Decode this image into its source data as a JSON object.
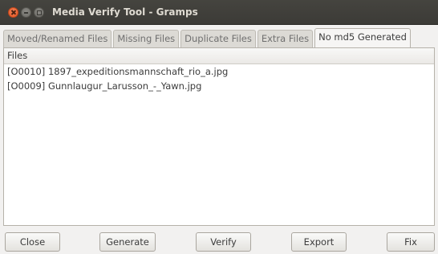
{
  "window": {
    "title": "Media Verify Tool - Gramps"
  },
  "tabs": [
    {
      "label": "Moved/Renamed Files",
      "active": false
    },
    {
      "label": "Missing Files",
      "active": false
    },
    {
      "label": "Duplicate Files",
      "active": false
    },
    {
      "label": "Extra Files",
      "active": false
    },
    {
      "label": "No md5 Generated",
      "active": true
    }
  ],
  "list": {
    "column_header": "Files",
    "rows": [
      "[O0010] 1897_expeditionsmannschaft_rio_a.jpg",
      "[O0009] Gunnlaugur_Larusson_-_Yawn.jpg"
    ]
  },
  "buttons": {
    "close": "Close",
    "generate": "Generate",
    "verify": "Verify",
    "export": "Export",
    "fix": "Fix"
  }
}
